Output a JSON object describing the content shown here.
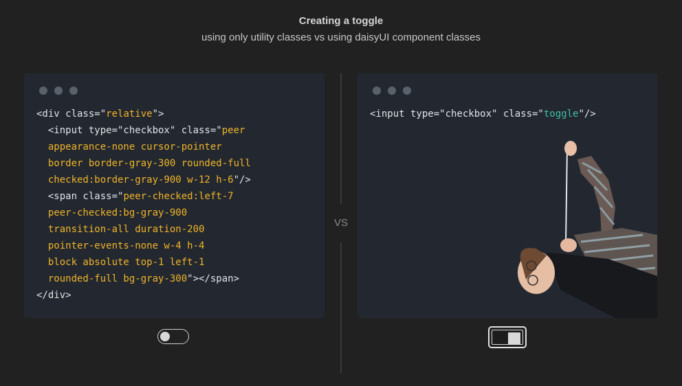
{
  "header": {
    "title": "Creating a toggle",
    "subtitle": "using only utility classes vs using daisyUI component classes"
  },
  "divider": {
    "label": "VS"
  },
  "left_panel": {
    "lines": [
      [
        {
          "t": "<div class=\"",
          "c": "tag"
        },
        {
          "t": "relative",
          "c": "val"
        },
        {
          "t": "\">",
          "c": "tag"
        }
      ],
      [
        {
          "t": "  <input type=\"checkbox\" class=\"",
          "c": "tag"
        },
        {
          "t": "peer",
          "c": "val"
        }
      ],
      [
        {
          "t": "  appearance-none cursor-pointer",
          "c": "val"
        }
      ],
      [
        {
          "t": "  border border-gray-300 rounded-full",
          "c": "val"
        }
      ],
      [
        {
          "t": "  checked:border-gray-900 w-12 h-6",
          "c": "val"
        },
        {
          "t": "\"/>",
          "c": "tag"
        }
      ],
      [
        {
          "t": "  <span class=\"",
          "c": "tag"
        },
        {
          "t": "peer-checked:left-7",
          "c": "val"
        }
      ],
      [
        {
          "t": "  peer-checked:bg-gray-900",
          "c": "val"
        }
      ],
      [
        {
          "t": "  transition-all duration-200",
          "c": "val"
        }
      ],
      [
        {
          "t": "  pointer-events-none w-4 h-4",
          "c": "val"
        }
      ],
      [
        {
          "t": "  block absolute top-1 left-1",
          "c": "val"
        }
      ],
      [
        {
          "t": "  rounded-full bg-gray-300",
          "c": "val"
        },
        {
          "t": "\"></span>",
          "c": "tag"
        }
      ],
      [
        {
          "t": "</div>",
          "c": "tag"
        }
      ]
    ],
    "toggle": {
      "state": "off"
    }
  },
  "right_panel": {
    "lines": [
      [
        {
          "t": "<input type=\"checkbox\" class=\"",
          "c": "tag"
        },
        {
          "t": "toggle",
          "c": "val2"
        },
        {
          "t": "\"/>",
          "c": "tag"
        }
      ]
    ],
    "toggle": {
      "state": "on"
    }
  },
  "colors": {
    "background": "#212121",
    "panel": "#232830",
    "class_value_utility": "#f0b429",
    "class_value_daisy": "#3fbfa8"
  }
}
